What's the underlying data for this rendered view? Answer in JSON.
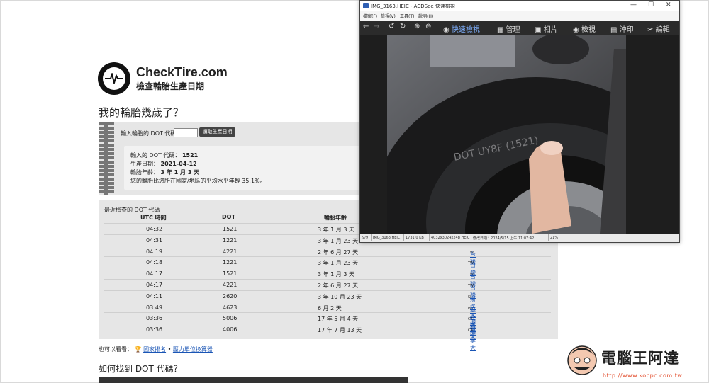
{
  "site": {
    "brand": "CheckTire.com",
    "subtitle": "檢查輪胎生產日期",
    "heading": "我的輪胎幾歲了？",
    "input_label": "輸入輪胎的 DOT 代碼",
    "input_value": "",
    "read_button": "讀取生產日期",
    "result": {
      "dot_label": "輸入的 DOT 代碼：",
      "dot_value": "1521",
      "date_label": "生產日期：",
      "date_value": "2021-04-12",
      "age_label": "輪胎年齡：",
      "age_value": "3 年 1 月 3 天",
      "note": "您的輪胎比您所在國家/地區的平均水平年輕 35.1%。"
    },
    "recent": {
      "title": "最近檢查的 DOT 代碼",
      "headers": [
        "UTC 時間",
        "DOT",
        "輪胎年齡"
      ],
      "rows": [
        {
          "time": "04:32",
          "dot": "1521",
          "age": "3 年 1 月 3 天",
          "cc": "",
          "country": ""
        },
        {
          "time": "04:31",
          "dot": "1221",
          "age": "3 年 1 月 23 天",
          "cc": "",
          "country": ""
        },
        {
          "time": "04:19",
          "dot": "4221",
          "age": "2 年 6 月 27 天",
          "cc": "TW",
          "country": "台灣"
        },
        {
          "time": "04:18",
          "dot": "1221",
          "age": "3 年 1 月 23 天",
          "cc": "TW",
          "country": "台灣"
        },
        {
          "time": "04:17",
          "dot": "1521",
          "age": "3 年 1 月 3 天",
          "cc": "TW",
          "country": "台灣"
        },
        {
          "time": "04:17",
          "dot": "4221",
          "age": "2 年 6 月 27 天",
          "cc": "TW",
          "country": "台灣"
        },
        {
          "time": "04:11",
          "dot": "2620",
          "age": "3 年 10 月 23 天",
          "cc": "SI",
          "country": "斯洛文尼亞"
        },
        {
          "time": "03:49",
          "dot": "4623",
          "age": "6 月 2 天",
          "cc": "PH",
          "country": "菲律賓"
        },
        {
          "time": "03:36",
          "dot": "5006",
          "age": "17 年 5 月 4 天",
          "cc": "CA",
          "country": "加拿大"
        },
        {
          "time": "03:36",
          "dot": "4006",
          "age": "17 年 7 月 13 天",
          "cc": "CA",
          "country": "加拿大"
        }
      ]
    },
    "see_also": {
      "prefix": "也可以看看：",
      "link1": "國家排名",
      "sep": "•",
      "link2": "壓力單位換算器"
    },
    "heading2": "如何找到 DOT 代碼？"
  },
  "acdsee": {
    "title": "IMG_3163.HEIC - ACDSee 快速檢視",
    "menu": [
      "檔案(F)",
      "檢視(V)",
      "工具(T)",
      "說明(H)"
    ],
    "toolbar": [
      "快速檢視",
      "管理",
      "相片",
      "檢視",
      "沖印",
      "編輯"
    ],
    "status": [
      "9/9",
      "IMG_3163.HEIC",
      "1731.0 KB",
      "4032x3024x24b HEIC",
      "修改日期：2024/5/15 上午 11:07:42",
      "21%"
    ],
    "tire_text": "DOT UY8F (1521)"
  },
  "watermark": {
    "name": "電腦王阿達",
    "url": "http://www.kocpc.com.tw"
  }
}
